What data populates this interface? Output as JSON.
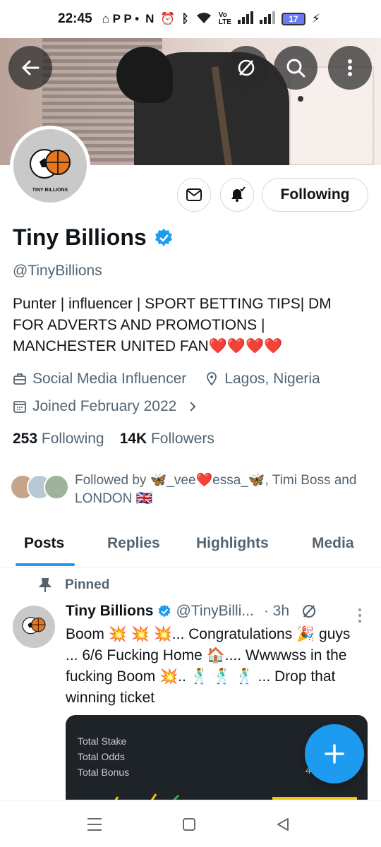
{
  "status_bar": {
    "time": "22:45",
    "notif_icons": "⌂ P P •",
    "battery": "17"
  },
  "header": {
    "back_icon": "arrow-left-icon",
    "grok_icon": "grok-slash-icon",
    "search_icon": "search-icon",
    "more_icon": "more-vertical-icon"
  },
  "profile": {
    "avatar_text": "TINY BILLIONS",
    "name": "Tiny Billions",
    "handle": "@TinyBillions",
    "bio": "Punter | influencer | SPORT BETTING TIPS| DM FOR ADVERTS AND PROMOTIONS | MANCHESTER UNITED FAN❤️❤️❤️❤️",
    "category": "Social Media Influencer",
    "location": "Lagos, Nigeria",
    "joined": "Joined February 2022",
    "following_count": "253",
    "following_label": "Following",
    "followers_count": "14K",
    "followers_label": "Followers",
    "followed_by": "Followed by 🦋_vee❤️essa_🦋, Timi Boss and LONDON 🇬🇧",
    "following_button": "Following"
  },
  "tabs": [
    {
      "label": "Posts",
      "active": true
    },
    {
      "label": "Replies",
      "active": false
    },
    {
      "label": "Highlights",
      "active": false
    },
    {
      "label": "Media",
      "active": false
    }
  ],
  "pinned_post": {
    "pinned_label": "Pinned",
    "author_name": "Tiny Billions",
    "author_handle": "@TinyBilli...",
    "time": "· 3h",
    "text": "Boom 💥 💥 💥... Congratulations 🎉 guys ... 6/6 Fucking Home 🏠.... Wwwwss in the fucking Boom 💥.. 🕺 🕺 🕺 ... Drop that winning ticket",
    "ticket": {
      "row1": "Total Stake",
      "row2": "Total Odds",
      "row3": "Total Bonus",
      "value3": "4"
    }
  },
  "colors": {
    "accent": "#1d9bf0",
    "secondary_text": "#536471",
    "primary_text": "#0f1419"
  }
}
